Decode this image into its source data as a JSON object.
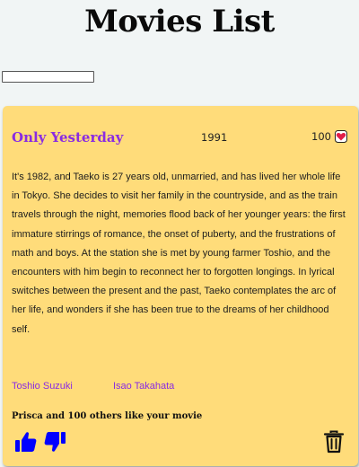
{
  "page": {
    "title": "Movies List"
  },
  "search": {
    "value": "",
    "placeholder": ""
  },
  "movie": {
    "title": "Only Yesterday",
    "year": "1991",
    "likes": "100",
    "description": "It's 1982, and Taeko is 27 years old, unmarried, and has lived her whole life in Tokyo. She decides to visit her family in the countryside, and as the train travels through the night, memories flood back of her younger years: the first immature stirrings of romance, the onset of puberty, and the frustrations of math and boys. At the station she is met by young farmer Toshio, and the encounters with him begin to reconnect her to forgotten longings. In lyrical switches between the present and the past, Taeko contemplates the arc of her life, and wonders if she has been true to the dreams of her childhood self.",
    "producer": "Toshio Suzuki",
    "director": "Isao Takahata",
    "social": {
      "friend": "Prisca",
      "and_text": " and ",
      "count": "100",
      "suffix": " others like your movie"
    }
  },
  "icons": {
    "heart": "heart-icon",
    "thumbs_up": "thumbs-up-icon",
    "thumbs_down": "thumbs-down-icon",
    "delete": "trash-icon"
  },
  "colors": {
    "card": "#ffdc7a",
    "accent": "#8a2be2",
    "thumb": "#0000ff",
    "heart": "#e11d48"
  }
}
